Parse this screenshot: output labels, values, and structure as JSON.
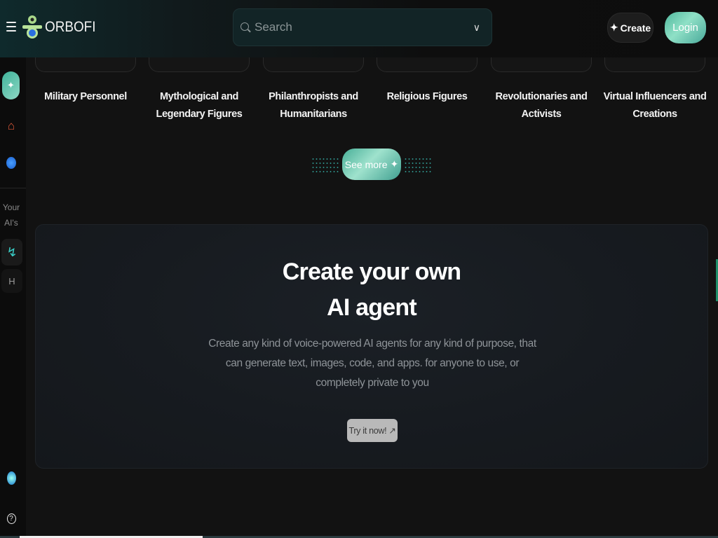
{
  "header": {
    "logo_text": "ORBOFI",
    "search_placeholder": "Search",
    "create_label": "Create",
    "login_label": "Login"
  },
  "sidebar": {
    "section_label_line1": "Your",
    "section_label_line2": "AI's",
    "agent_initial": "H"
  },
  "categories": [
    {
      "label_line1": "Military Personnel",
      "label_line2": ""
    },
    {
      "label_line1": "Mythological and",
      "label_line2": "Legendary Figures"
    },
    {
      "label_line1": "Philanthropists and",
      "label_line2": "Humanitarians"
    },
    {
      "label_line1": "Religious Figures",
      "label_line2": ""
    },
    {
      "label_line1": "Revolutionaries and",
      "label_line2": "Activists"
    },
    {
      "label_line1": "Virtual Influencers and",
      "label_line2": "Creations"
    }
  ],
  "see_more_label": "See more",
  "promo": {
    "title_line1": "Create your own",
    "title_line2": "AI agent",
    "description": "Create any kind of voice-powered AI agents for any kind of purpose, that can generate text, images, code, and apps. for anyone to use, or completely private to you",
    "cta_label": "Try it now!"
  },
  "colors": {
    "accent": "#5fc4ad",
    "background": "#121212"
  }
}
